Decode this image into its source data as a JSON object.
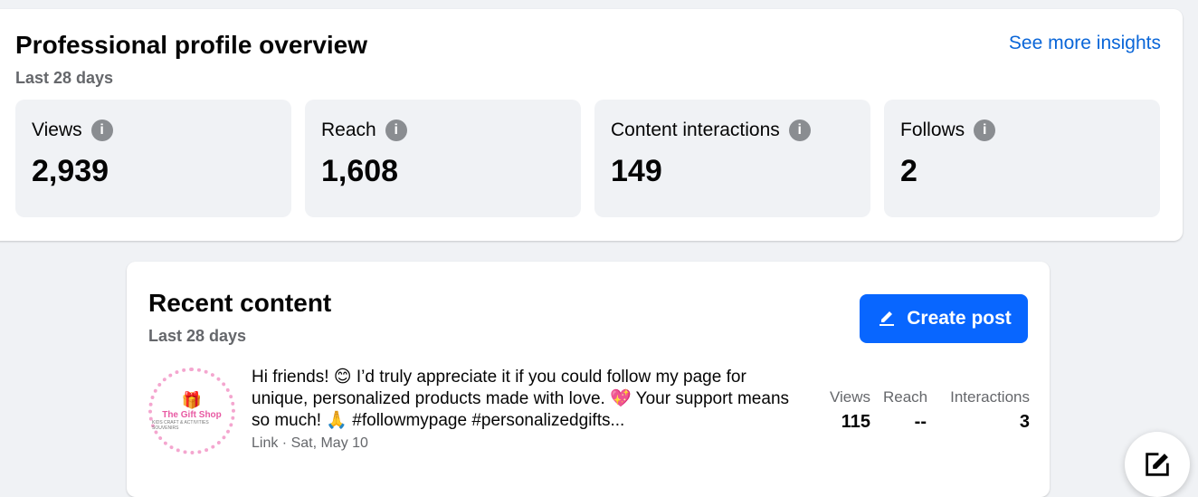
{
  "overview": {
    "title": "Professional profile overview",
    "period": "Last 28 days",
    "insights_link": "See more insights",
    "metrics": [
      {
        "label": "Views",
        "value": "2,939"
      },
      {
        "label": "Reach",
        "value": "1,608"
      },
      {
        "label": "Content interactions",
        "value": "149"
      },
      {
        "label": "Follows",
        "value": "2"
      }
    ],
    "info_icon": "i"
  },
  "recent": {
    "title": "Recent content",
    "period": "Last 28 days",
    "create_button": "Create post",
    "post": {
      "thumbnail_text": "The Gift Shop",
      "thumbnail_subtext": "KIDS CRAFT & ACTIVITIES SOUVENIRS",
      "text": "Hi friends! 😊 I’d truly appreciate it if you could follow my page for unique, personalized products made with love. 💖 Your support means so much! 🙏 #followmypage #personalizedgifts...",
      "meta": "Link · Sat, May 10",
      "stats": [
        {
          "label": "Views",
          "value": "115"
        },
        {
          "label": "Reach",
          "value": "--"
        },
        {
          "label": "Interactions",
          "value": "3"
        }
      ]
    }
  },
  "colors": {
    "accent": "#0866ff",
    "link": "#0a66d8",
    "background": "#f0f2f5"
  },
  "icons": {
    "info": "info-icon",
    "edit": "edit-icon",
    "compose": "compose-icon"
  }
}
